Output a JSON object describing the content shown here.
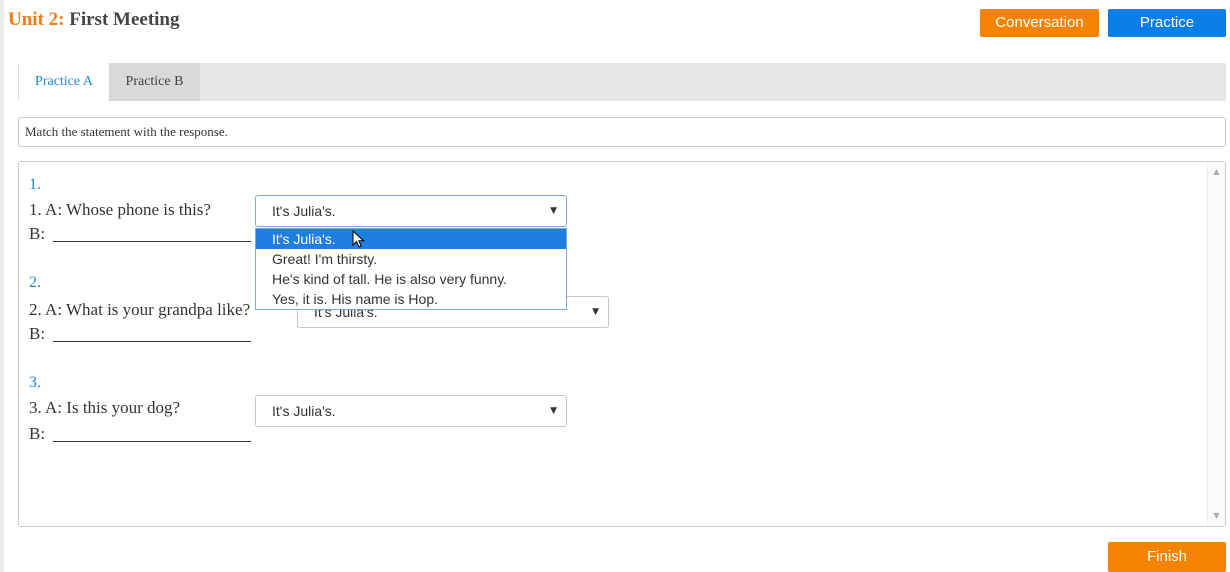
{
  "header": {
    "unit_label": "Unit 2:",
    "unit_title": "First Meeting",
    "conversation_label": "Conversation",
    "practice_label": "Practice"
  },
  "tabs": [
    {
      "label": "Practice A",
      "active": true
    },
    {
      "label": "Practice B",
      "active": false
    }
  ],
  "instruction": "Match the statement with the response.",
  "questions": [
    {
      "number": "1.",
      "statement": "1. A: Whose phone is this?",
      "response_prefix": "B:",
      "selected": "It's Julia's."
    },
    {
      "number": "2.",
      "statement": "2. A: What is your grandpa like?",
      "response_prefix": "B:",
      "selected": "It's Julia's."
    },
    {
      "number": "3.",
      "statement": "3. A: Is this your dog?",
      "response_prefix": "B:",
      "selected": "It's Julia's."
    }
  ],
  "dropdown_options": [
    "It's Julia's.",
    "Great! I'm thirsty.",
    "He's kind of tall. He is also very funny.",
    "Yes, it is. His name is Hop."
  ],
  "footer": {
    "finish_label": "Finish"
  },
  "colors": {
    "orange": "#f48400",
    "blue": "#0a7ee6",
    "link_blue": "#1e88d6",
    "highlight": "#1e7fe0"
  }
}
